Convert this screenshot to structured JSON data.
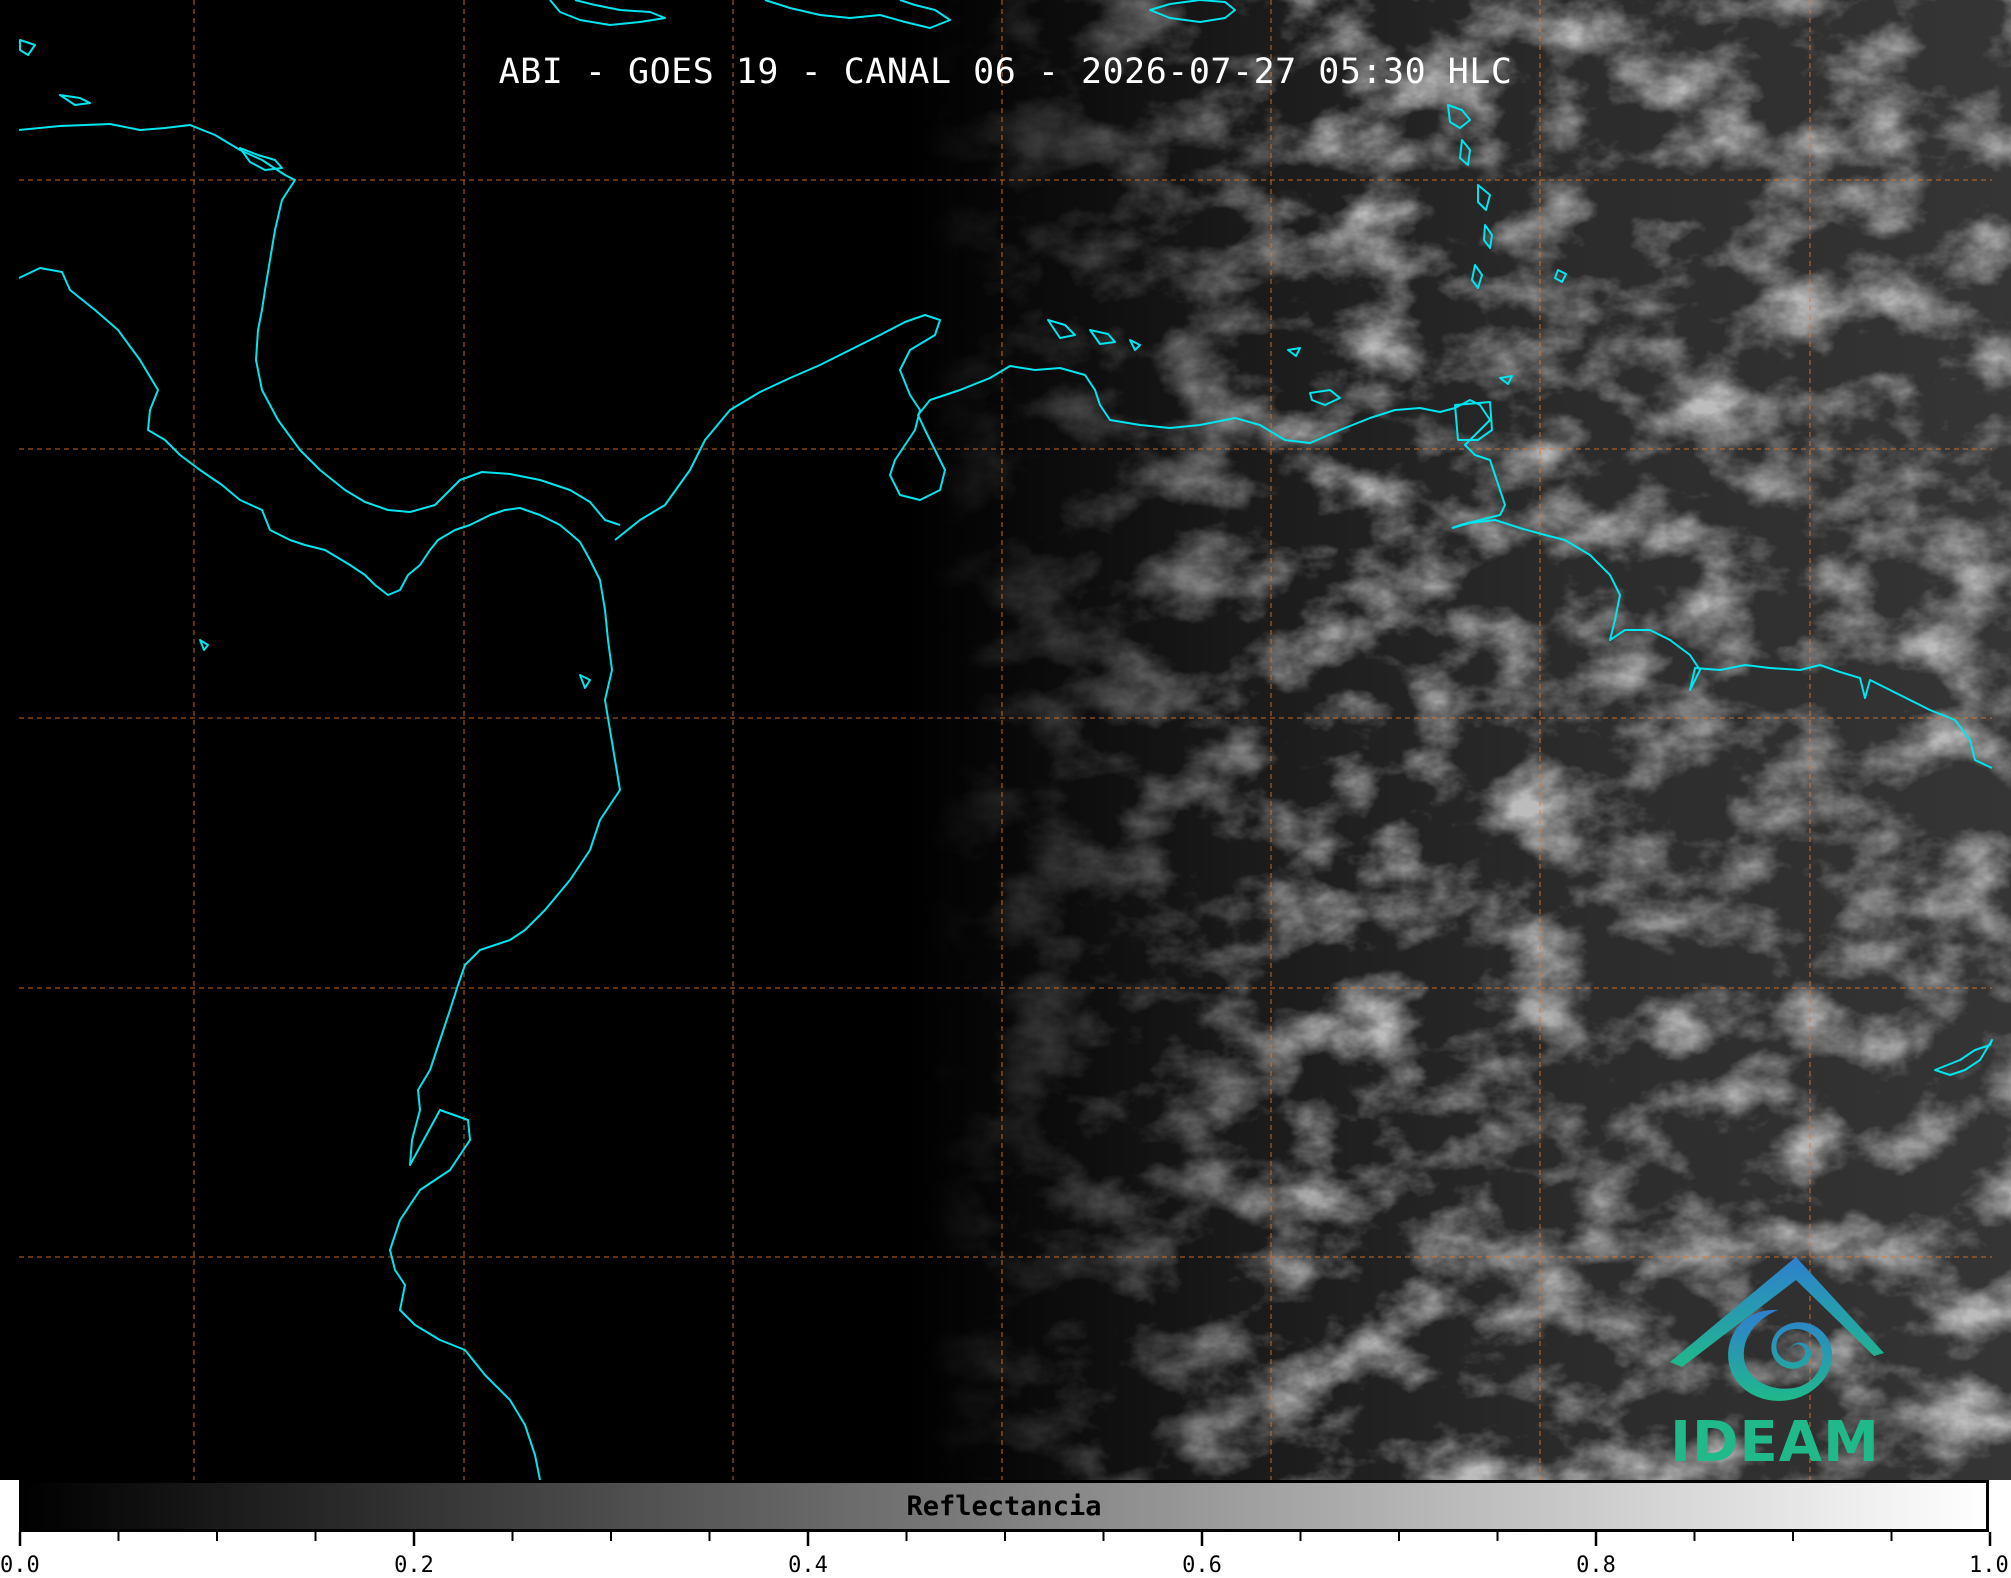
{
  "title": "ABI - GOES 19 - CANAL 06 - 2026-07-27 05:30 HLC",
  "map": {
    "coastline_color": "#00e5ee",
    "gridline_color": "#e0782a",
    "gridline_style": "dashed",
    "background_color": "#000000",
    "cloud_region": "east half of image (night terminator), grey cloud texture"
  },
  "colorbar": {
    "label": "Reflectancia",
    "min": 0.0,
    "max": 1.0,
    "colormap": "grey: black to white",
    "major_ticks": [
      "0.0",
      "0.2",
      "0.4",
      "0.6",
      "0.8",
      "1.0"
    ],
    "minor_tick_step": 0.05
  },
  "logo": {
    "text": "IDEAM",
    "color_top": "#2f7fd0",
    "color_bottom": "#1fb98a"
  }
}
